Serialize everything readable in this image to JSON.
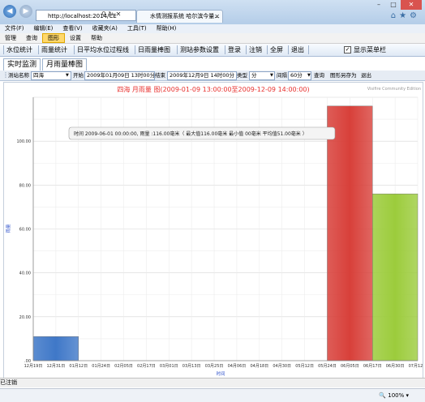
{
  "browser": {
    "address": "http://localhost:2014/CE",
    "tab_title": "水情测报系统 哈尔滨今量...",
    "menu": [
      "文件(F)",
      "编辑(E)",
      "查看(V)",
      "收藏夹(A)",
      "工具(T)",
      "帮助(H)"
    ]
  },
  "app_menu": {
    "items": [
      "管理",
      "查询",
      "图形",
      "设置",
      "帮助"
    ],
    "active": "图形"
  },
  "toolbar": {
    "items": [
      "水位统计",
      "雨量统计",
      "日平均水位过程线",
      "日雨量棒图",
      "测站参数设置",
      "登录",
      "注销",
      "全屏",
      "退出"
    ],
    "show_menubar": "显示菜单栏",
    "show_menubar_checked": true
  },
  "subtabs": [
    "实时监测",
    "月雨量棒图"
  ],
  "params": {
    "station_label": "测站名称",
    "station_value": "四海",
    "start_label": "开始",
    "start_value": "2009年01月09日 13时00分",
    "end_label": "结束",
    "end_value": "2009年12月9日 14时00分",
    "type_label": "类型",
    "type_value": "分",
    "interval_label": "间隔",
    "interval_value": "60分",
    "query_label": "查询",
    "saveas_label": "图形另存为",
    "exit_label": "退出"
  },
  "status_text": "已注销",
  "zoom": "100%",
  "chart_data": {
    "type": "bar",
    "title": "四海 月雨量 图(2009-01-09 13:00:00至2009-12-09 14:00:00)",
    "watermark": "Visifire Community Edition",
    "tooltip": "时间  2009-06-01 00:00:00, 雨量 :116.00毫米（  最大值116.00毫米    最小值 00毫米    平均值51.00毫米 ）",
    "xlabel": "时间",
    "ylabel": "雨量",
    "ylim": [
      0,
      120
    ],
    "yticks": [
      ".00",
      "20.00",
      "40.00",
      "60.00",
      "80.00",
      "100.00"
    ],
    "categories": [
      "12月19日",
      "12月31日",
      "01月12日",
      "01月24日",
      "02月05日",
      "02月17日",
      "03月01日",
      "03月13日",
      "03月25日",
      "04月06日",
      "04月18日",
      "04月30日",
      "05月12日",
      "05月24日",
      "06月05日",
      "06月17日",
      "06月30日",
      "07月12日"
    ],
    "bars": [
      {
        "start": "12月19日",
        "end": "01月12日",
        "value": 11,
        "color": "#3f78c8"
      },
      {
        "start": "05月24日",
        "end": "06月17日",
        "value": 116,
        "color": "#d8403a"
      },
      {
        "start": "06月17日",
        "end": "07月12日",
        "value": 76,
        "color": "#9ccc3c"
      }
    ],
    "grid": true
  }
}
